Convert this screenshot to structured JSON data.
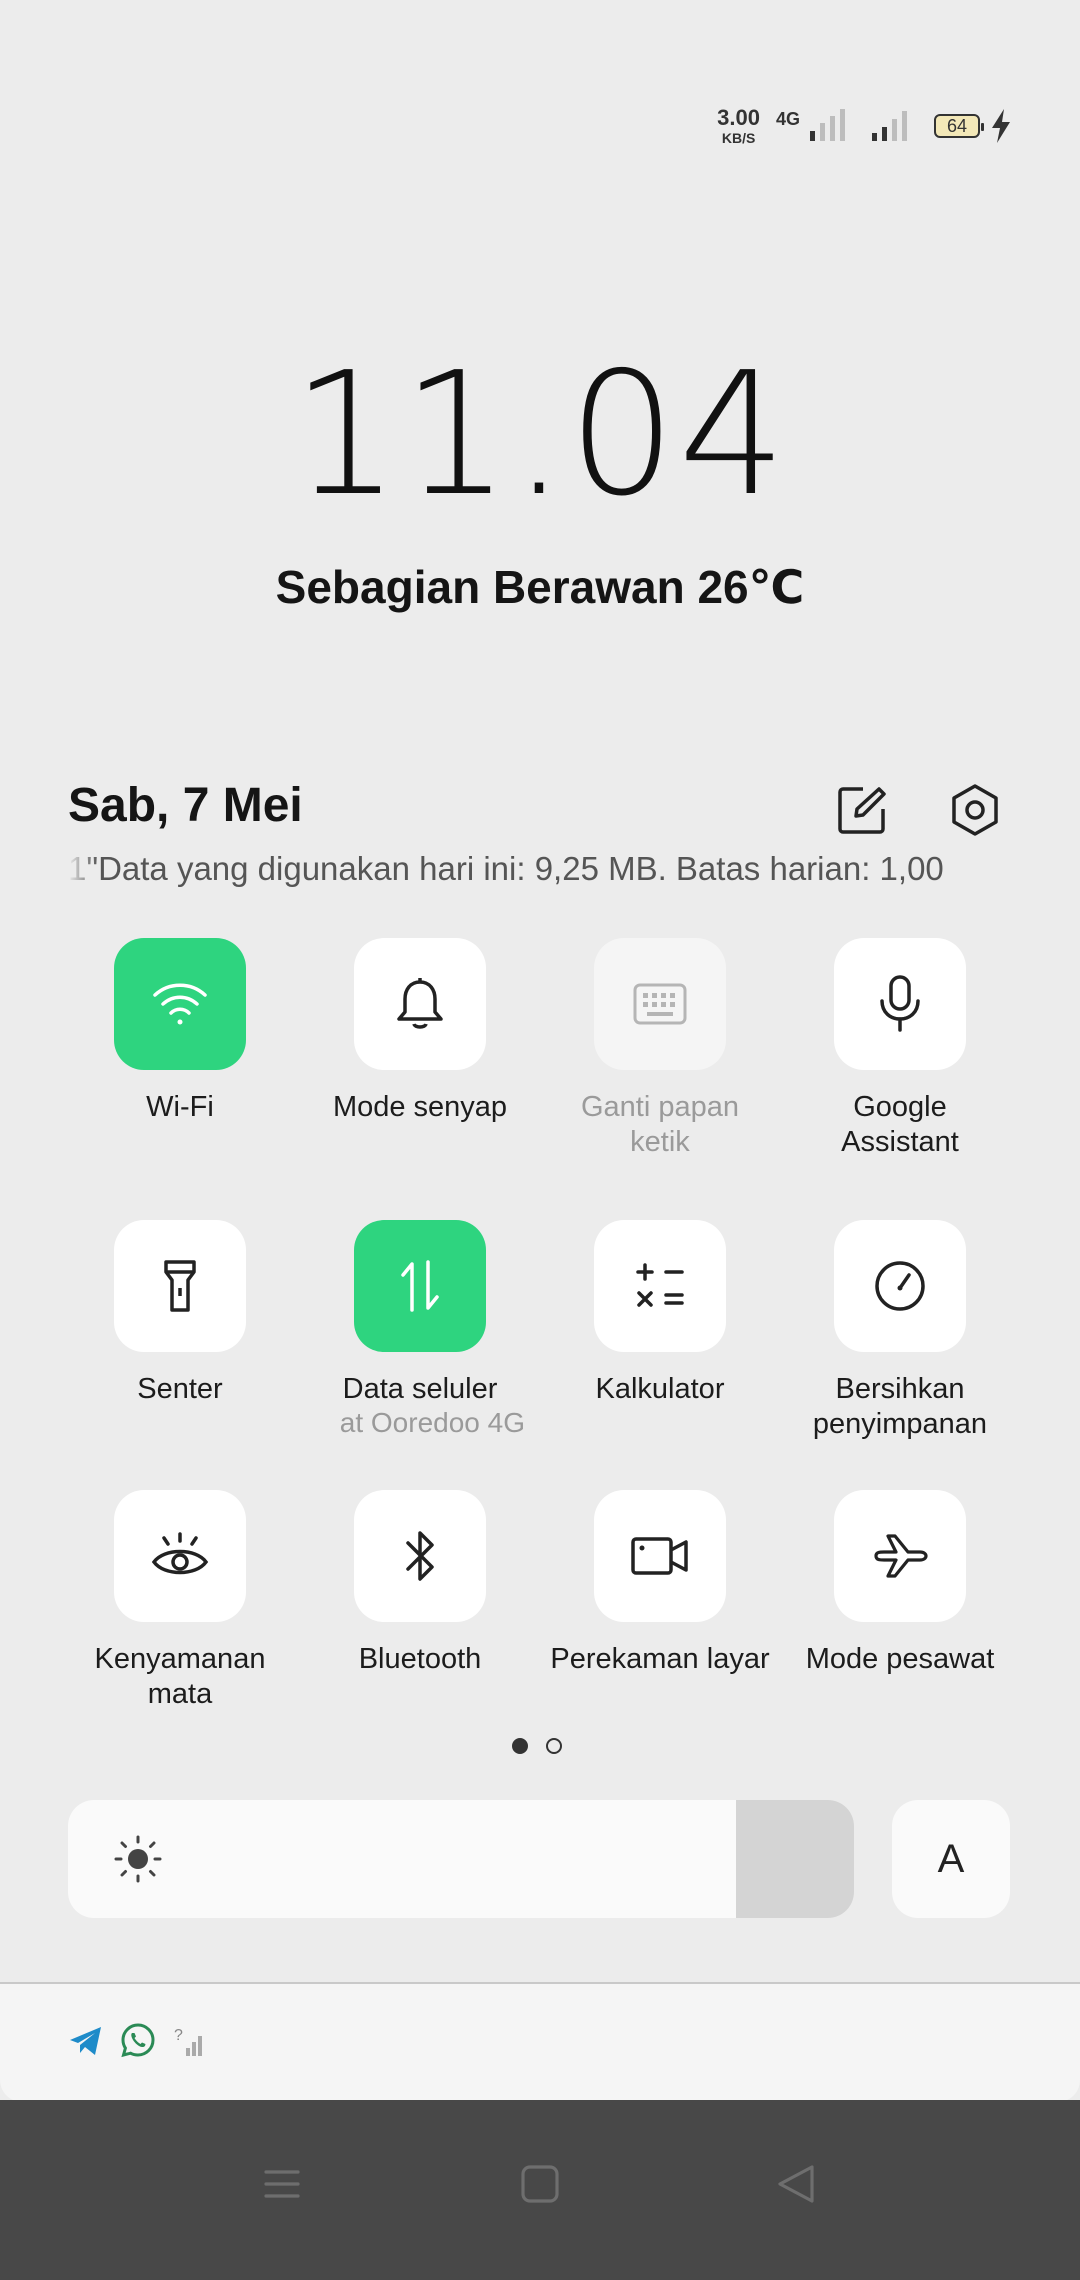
{
  "status_bar": {
    "net_speed_value": "3.00",
    "net_speed_unit": "KB/S",
    "network_type": "4G",
    "battery_level": "64"
  },
  "lockscreen": {
    "time": "11.04",
    "weather": "Sebagian Berawan 26℃"
  },
  "panel": {
    "date": "Sab, 7 Mei",
    "data_usage_marquee": "1\"Data yang digunakan hari ini: 9,25 MB. Batas harian: 1,00"
  },
  "tiles": [
    {
      "label": "Wi-Fi",
      "icon": "wifi-icon",
      "state": "on"
    },
    {
      "label": "Mode senyap",
      "icon": "bell-icon",
      "state": "off"
    },
    {
      "label": "Ganti papan ketik",
      "icon": "keyboard-icon",
      "state": "disabled"
    },
    {
      "label": "Google Assistant",
      "icon": "microphone-icon",
      "state": "off"
    },
    {
      "label": "Senter",
      "icon": "flashlight-icon",
      "state": "off"
    },
    {
      "label": "Data seluler",
      "sublabel": "at Ooredoo  4G",
      "icon": "mobile-data-icon",
      "state": "on"
    },
    {
      "label": "Kalkulator",
      "icon": "calculator-icon",
      "state": "off"
    },
    {
      "label": "Bersihkan penyimpanan",
      "icon": "storage-cleanup-icon",
      "state": "off"
    },
    {
      "label": "Kenyamanan mata",
      "icon": "eye-comfort-icon",
      "state": "off"
    },
    {
      "label": "Bluetooth",
      "icon": "bluetooth-icon",
      "state": "off"
    },
    {
      "label": "Perekaman layar",
      "icon": "screen-record-icon",
      "state": "off"
    },
    {
      "label": "Mode pesawat",
      "icon": "airplane-icon",
      "state": "off"
    }
  ],
  "page_indicator": {
    "current": 1,
    "total": 2
  },
  "brightness": {
    "level": 0.85,
    "auto_label": "A"
  },
  "colors": {
    "accent": "#2ed47f",
    "background": "#ececec",
    "nav_bar": "#484848"
  }
}
